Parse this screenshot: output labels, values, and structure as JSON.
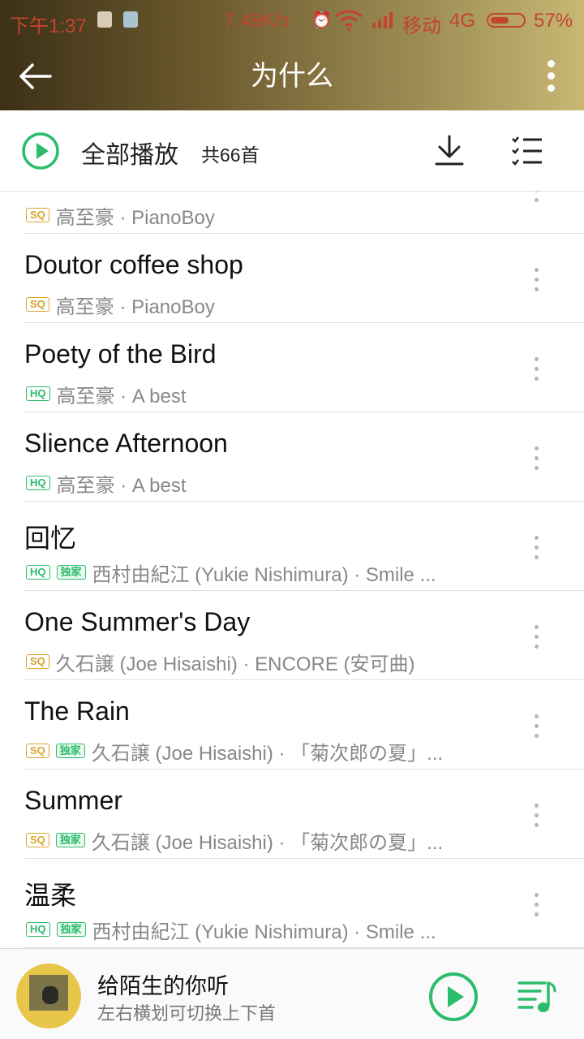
{
  "status_bar": {
    "time": "下午1:37",
    "net_speed": "7.49K/s",
    "carrier": "移动",
    "network": "4G",
    "battery": "57%",
    "battery_level": 0.57
  },
  "header": {
    "title": "为什么"
  },
  "play_all": {
    "label": "全部播放",
    "count": "共66首"
  },
  "songs": [
    {
      "title": "",
      "badges": [
        "SQ"
      ],
      "subtitle": "高至豪 · PianoBoy"
    },
    {
      "title": "Doutor coffee shop",
      "badges": [
        "SQ"
      ],
      "subtitle": "高至豪 · PianoBoy"
    },
    {
      "title": "Poety of the Bird",
      "badges": [
        "HQ"
      ],
      "subtitle": "高至豪 · A best"
    },
    {
      "title": "Slience Afternoon",
      "badges": [
        "HQ"
      ],
      "subtitle": "高至豪 · A best"
    },
    {
      "title": "回忆",
      "badges": [
        "HQ",
        "独家"
      ],
      "subtitle": "西村由紀江 (Yukie Nishimura) · Smile ..."
    },
    {
      "title": "One Summer's Day",
      "badges": [
        "SQ"
      ],
      "subtitle": "久石譲 (Joe Hisaishi) · ENCORE (安可曲)"
    },
    {
      "title": "The Rain",
      "badges": [
        "SQ",
        "独家"
      ],
      "subtitle": "久石譲 (Joe Hisaishi) · 「菊次郎の夏」..."
    },
    {
      "title": "Summer",
      "badges": [
        "SQ",
        "独家"
      ],
      "subtitle": "久石譲 (Joe Hisaishi) · 「菊次郎の夏」..."
    },
    {
      "title": "温柔",
      "badges": [
        "HQ",
        "独家"
      ],
      "subtitle": "西村由紀江 (Yukie Nishimura) · Smile ..."
    }
  ],
  "now_playing": {
    "title": "给陌生的你听",
    "hint": "左右横划可切换上下首"
  },
  "colors": {
    "accent_green": "#2bbc6c",
    "sq_gold": "#d9a42a",
    "status_red": "#c3442f"
  },
  "icons": {
    "back": "arrow-left-icon",
    "more": "vertical-dots-icon",
    "play_all": "play-circle-icon",
    "download": "download-icon",
    "multi_select": "checklist-icon",
    "play": "play-circle-icon",
    "queue": "playlist-icon"
  }
}
